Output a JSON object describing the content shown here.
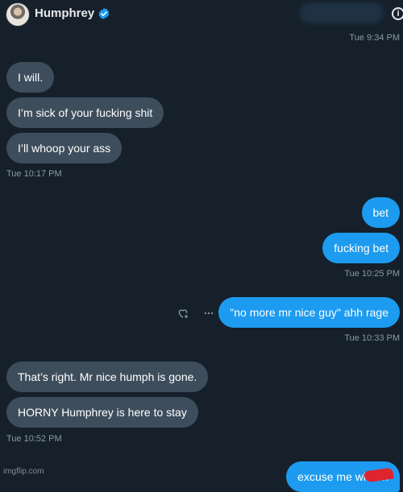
{
  "header": {
    "name": "Humphrey",
    "info_glyph": "i"
  },
  "messages": [
    {
      "time": "Tue 9:34 PM"
    },
    {
      "text": "I will."
    },
    {
      "text": "I’m sick of your fucking shit"
    },
    {
      "text": "I’ll whoop your ass"
    },
    {
      "time": "Tue 10:17 PM"
    },
    {
      "text": "bet"
    },
    {
      "text": "fucking bet"
    },
    {
      "time": "Tue 10:25 PM"
    },
    {
      "text": "\"no more mr nice guy\" ahh rage"
    },
    {
      "time": "Tue 10:33 PM"
    },
    {
      "text": "That’s right. Mr nice humph is gone."
    },
    {
      "text": "HORNY Humphrey is here to stay"
    },
    {
      "time": "Tue 10:52 PM"
    },
    {
      "text": "excuse me what n"
    }
  ],
  "watermark": "imgflip.com",
  "colors": {
    "background": "#15202b",
    "incoming_bubble": "#3e4d5c",
    "outgoing_bubble": "#1d9bf0",
    "timestamp": "#8b98a5",
    "verified_badge": "#1d9bf0"
  },
  "icons": {
    "verified": "verified-badge-icon",
    "info": "info-icon",
    "react": "add-reaction-icon",
    "more": "more-options-icon"
  }
}
